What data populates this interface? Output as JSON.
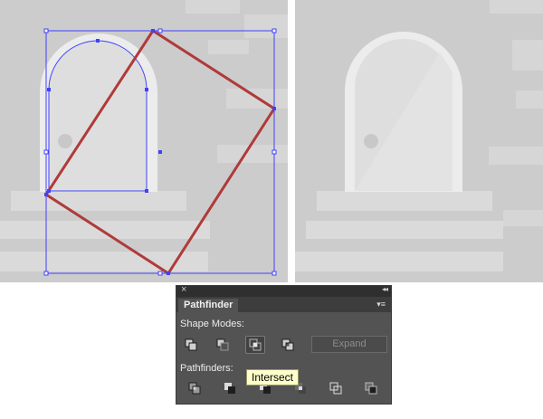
{
  "panel": {
    "close_glyph": "×",
    "collapse_glyph": "◂◂",
    "menu_glyph": "▾≡",
    "tab_label": "Pathfinder",
    "shape_modes_label": "Shape Modes:",
    "pathfinders_label": "Pathfinders:",
    "expand_label": "Expand",
    "tooltip": "Intersect"
  },
  "shape_mode_buttons": [
    {
      "name": "unite",
      "icon": "unite-icon",
      "active": false
    },
    {
      "name": "minus-front",
      "icon": "minus-front-icon",
      "active": false
    },
    {
      "name": "intersect",
      "icon": "intersect-icon",
      "active": true
    },
    {
      "name": "exclude",
      "icon": "exclude-icon",
      "active": false
    }
  ],
  "pathfinder_buttons": [
    {
      "name": "divide",
      "icon": "divide-icon"
    },
    {
      "name": "trim",
      "icon": "trim-icon"
    },
    {
      "name": "merge",
      "icon": "merge-icon"
    },
    {
      "name": "crop",
      "icon": "crop-icon"
    },
    {
      "name": "outline",
      "icon": "outline-icon"
    },
    {
      "name": "minus-back",
      "icon": "minus-back-icon"
    }
  ],
  "colors": {
    "canvas_bg": "#cccccc",
    "block_light": "#dadada",
    "door_white": "#ececec",
    "door_fill": "#dedede",
    "selection_blue": "#4040ff",
    "shape_red": "#b03a3a",
    "panel_bg": "#535353",
    "tooltip_bg": "#ffffcc"
  }
}
